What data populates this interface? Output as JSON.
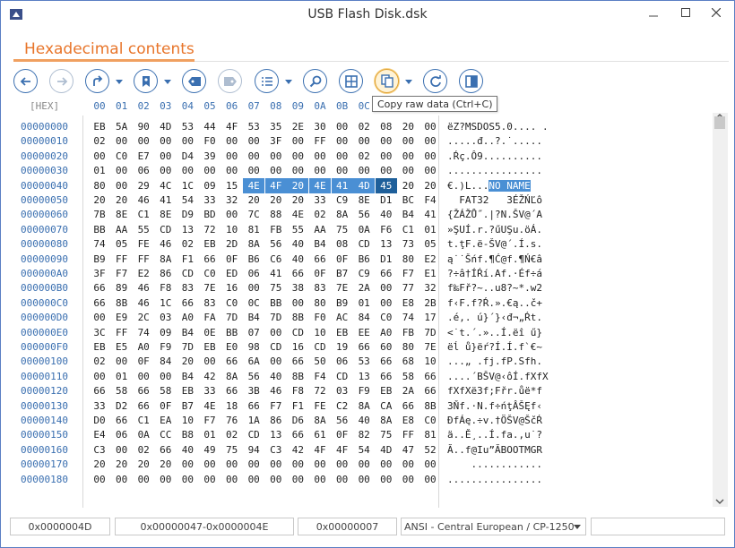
{
  "window": {
    "title": "USB Flash Disk.dsk"
  },
  "section": {
    "title": "Hexadecimal contents"
  },
  "toolbar": {
    "tooltip": "Copy raw data (Ctrl+C)",
    "buttons": [
      {
        "name": "back-button",
        "icon": "arrow-left-icon"
      },
      {
        "name": "forward-button",
        "icon": "arrow-right-icon"
      },
      {
        "name": "go-to-button",
        "icon": "redo-arrow-icon"
      },
      {
        "name": "bookmark-button",
        "icon": "bookmark-icon"
      },
      {
        "name": "previous-bookmark-button",
        "icon": "tag-left-icon"
      },
      {
        "name": "next-bookmark-button",
        "icon": "tag-right-icon"
      },
      {
        "name": "list-button",
        "icon": "list-icon"
      },
      {
        "name": "search-button",
        "icon": "search-icon"
      },
      {
        "name": "columns-button",
        "icon": "grid-icon"
      },
      {
        "name": "copy-raw-button",
        "icon": "copy-icon"
      },
      {
        "name": "refresh-button",
        "icon": "refresh-icon"
      },
      {
        "name": "panel-button",
        "icon": "panel-icon"
      }
    ]
  },
  "hex": {
    "header_label": "[HEX]",
    "columns": [
      "00",
      "01",
      "02",
      "03",
      "04",
      "05",
      "06",
      "07",
      "08",
      "09",
      "0A",
      "0B",
      "0C",
      "0D",
      "0E",
      "0F"
    ],
    "rows": [
      {
        "offset": "00000000",
        "bytes": [
          "EB",
          "5A",
          "90",
          "4D",
          "53",
          "44",
          "4F",
          "53",
          "35",
          "2E",
          "30",
          "00",
          "02",
          "08",
          "20",
          "00"
        ],
        "text": "ëZ?MSDOS5.0.... ."
      },
      {
        "offset": "00000010",
        "bytes": [
          "02",
          "00",
          "00",
          "00",
          "00",
          "F0",
          "00",
          "00",
          "3F",
          "00",
          "FF",
          "00",
          "00",
          "00",
          "00",
          "00"
        ],
        "text": ".....đ..?.˙....."
      },
      {
        "offset": "00000020",
        "bytes": [
          "00",
          "C0",
          "E7",
          "00",
          "D4",
          "39",
          "00",
          "00",
          "00",
          "00",
          "00",
          "00",
          "02",
          "00",
          "00",
          "00"
        ],
        "text": ".Ŕç.Ô9.........."
      },
      {
        "offset": "00000030",
        "bytes": [
          "01",
          "00",
          "06",
          "00",
          "00",
          "00",
          "00",
          "00",
          "00",
          "00",
          "00",
          "00",
          "00",
          "00",
          "00",
          "00"
        ],
        "text": "................"
      },
      {
        "offset": "00000040",
        "bytes": [
          "80",
          "00",
          "29",
          "4C",
          "1C",
          "09",
          "15",
          "4E",
          "4F",
          "20",
          "4E",
          "41",
          "4D",
          "45",
          "20",
          "20"
        ],
        "text_pre": "€.)L...",
        "text_sel": "NO NAME",
        "text_post": "  "
      },
      {
        "offset": "00000050",
        "bytes": [
          "20",
          "20",
          "46",
          "41",
          "54",
          "33",
          "32",
          "20",
          "20",
          "20",
          "33",
          "C9",
          "8E",
          "D1",
          "BC",
          "F4"
        ],
        "text": "  FAT32   3ÉŽŃĽô"
      },
      {
        "offset": "00000060",
        "bytes": [
          "7B",
          "8E",
          "C1",
          "8E",
          "D9",
          "BD",
          "00",
          "7C",
          "88",
          "4E",
          "02",
          "8A",
          "56",
          "40",
          "B4",
          "41"
        ],
        "text": "{ŽÁŽŮ˝.|?N.ŠV@´A"
      },
      {
        "offset": "00000070",
        "bytes": [
          "BB",
          "AA",
          "55",
          "CD",
          "13",
          "72",
          "10",
          "81",
          "FB",
          "55",
          "AA",
          "75",
          "0A",
          "F6",
          "C1",
          "01"
        ],
        "text": "»ŞUÍ.r.?űUŞu.öÁ."
      },
      {
        "offset": "00000080",
        "bytes": [
          "74",
          "05",
          "FE",
          "46",
          "02",
          "EB",
          "2D",
          "8A",
          "56",
          "40",
          "B4",
          "08",
          "CD",
          "13",
          "73",
          "05"
        ],
        "text": "t.ţF.ë-ŠV@´.Í.s."
      },
      {
        "offset": "00000090",
        "bytes": [
          "B9",
          "FF",
          "FF",
          "8A",
          "F1",
          "66",
          "0F",
          "B6",
          "C6",
          "40",
          "66",
          "0F",
          "B6",
          "D1",
          "80",
          "E2"
        ],
        "text": "ą˙˙Šńf.¶Ć@f.¶Ń€â"
      },
      {
        "offset": "000000A0",
        "bytes": [
          "3F",
          "F7",
          "E2",
          "86",
          "CD",
          "C0",
          "ED",
          "06",
          "41",
          "66",
          "0F",
          "B7",
          "C9",
          "66",
          "F7",
          "E1"
        ],
        "text": "?÷â†ÍŔí.Af.·Éf÷á"
      },
      {
        "offset": "000000B0",
        "bytes": [
          "66",
          "89",
          "46",
          "F8",
          "83",
          "7E",
          "16",
          "00",
          "75",
          "38",
          "83",
          "7E",
          "2A",
          "00",
          "77",
          "32"
        ],
        "text": "f‰Fř?~..u8?~*.w2"
      },
      {
        "offset": "000000C0",
        "bytes": [
          "66",
          "8B",
          "46",
          "1C",
          "66",
          "83",
          "C0",
          "0C",
          "BB",
          "00",
          "80",
          "B9",
          "01",
          "00",
          "E8",
          "2B"
        ],
        "text": "f‹F.f?Ŕ.».€ą..č+"
      },
      {
        "offset": "000000D0",
        "bytes": [
          "00",
          "E9",
          "2C",
          "03",
          "A0",
          "FA",
          "7D",
          "B4",
          "7D",
          "8B",
          "F0",
          "AC",
          "84",
          "C0",
          "74",
          "17"
        ],
        "text": ".é,. ú}´}‹đ¬„Ŕt."
      },
      {
        "offset": "000000E0",
        "bytes": [
          "3C",
          "FF",
          "74",
          "09",
          "B4",
          "0E",
          "BB",
          "07",
          "00",
          "CD",
          "10",
          "EB",
          "EE",
          "A0",
          "FB",
          "7D"
        ],
        "text": "<˙t.´.»..Í.ëî ű}"
      },
      {
        "offset": "000000F0",
        "bytes": [
          "EB",
          "E5",
          "A0",
          "F9",
          "7D",
          "EB",
          "E0",
          "98",
          "CD",
          "16",
          "CD",
          "19",
          "66",
          "60",
          "80",
          "7E"
        ],
        "text": "ëĺ ů}ëŕ?Í.Í.f`€~"
      },
      {
        "offset": "00000100",
        "bytes": [
          "02",
          "00",
          "0F",
          "84",
          "20",
          "00",
          "66",
          "6A",
          "00",
          "66",
          "50",
          "06",
          "53",
          "66",
          "68",
          "10"
        ],
        "text": "...„ .fj.fP.Sfh."
      },
      {
        "offset": "00000110",
        "bytes": [
          "00",
          "01",
          "00",
          "00",
          "B4",
          "42",
          "8A",
          "56",
          "40",
          "8B",
          "F4",
          "CD",
          "13",
          "66",
          "58",
          "66"
        ],
        "text": "....´BŠV@‹ôÍ.fXfX"
      },
      {
        "offset": "00000120",
        "bytes": [
          "66",
          "58",
          "66",
          "58",
          "EB",
          "33",
          "66",
          "3B",
          "46",
          "F8",
          "72",
          "03",
          "F9",
          "EB",
          "2A",
          "66"
        ],
        "text": "fXfXë3f;Fřr.ůë*f"
      },
      {
        "offset": "00000130",
        "bytes": [
          "33",
          "D2",
          "66",
          "0F",
          "B7",
          "4E",
          "18",
          "66",
          "F7",
          "F1",
          "FE",
          "C2",
          "8A",
          "CA",
          "66",
          "8B"
        ],
        "text": "3Ňf.·N.f÷ńţÂŠĘf‹"
      },
      {
        "offset": "00000140",
        "bytes": [
          "D0",
          "66",
          "C1",
          "EA",
          "10",
          "F7",
          "76",
          "1A",
          "86",
          "D6",
          "8A",
          "56",
          "40",
          "8A",
          "E8",
          "C0"
        ],
        "text": "ĐfÁę.÷v.†ÖŠV@ŠčŔ"
      },
      {
        "offset": "00000150",
        "bytes": [
          "E4",
          "06",
          "0A",
          "CC",
          "B8",
          "01",
          "02",
          "CD",
          "13",
          "66",
          "61",
          "0F",
          "82",
          "75",
          "FF",
          "81"
        ],
        "text": "ä..Ě¸..Í.fa.‚u˙?"
      },
      {
        "offset": "00000160",
        "bytes": [
          "C3",
          "00",
          "02",
          "66",
          "40",
          "49",
          "75",
          "94",
          "C3",
          "42",
          "4F",
          "4F",
          "54",
          "4D",
          "47",
          "52"
        ],
        "text": "Ă..f@Iu”ĂBOOTMGR"
      },
      {
        "offset": "00000170",
        "bytes": [
          "20",
          "20",
          "20",
          "20",
          "00",
          "00",
          "00",
          "00",
          "00",
          "00",
          "00",
          "00",
          "00",
          "00",
          "00",
          "00"
        ],
        "text": "    ............"
      },
      {
        "offset": "00000180",
        "bytes": [
          "00",
          "00",
          "00",
          "00",
          "00",
          "00",
          "00",
          "00",
          "00",
          "00",
          "00",
          "00",
          "00",
          "00",
          "00",
          "00"
        ],
        "text": "................"
      }
    ]
  },
  "status": {
    "cursor": "0x0000004D",
    "selection": "0x00000047-0x0000004E",
    "length": "0x00000007",
    "encoding": "ANSI - Central European / CP-1250",
    "extra": ""
  },
  "colors": {
    "accent": "#e8752a",
    "selection": "#4a8fd4",
    "offset": "#3a6fb0"
  }
}
